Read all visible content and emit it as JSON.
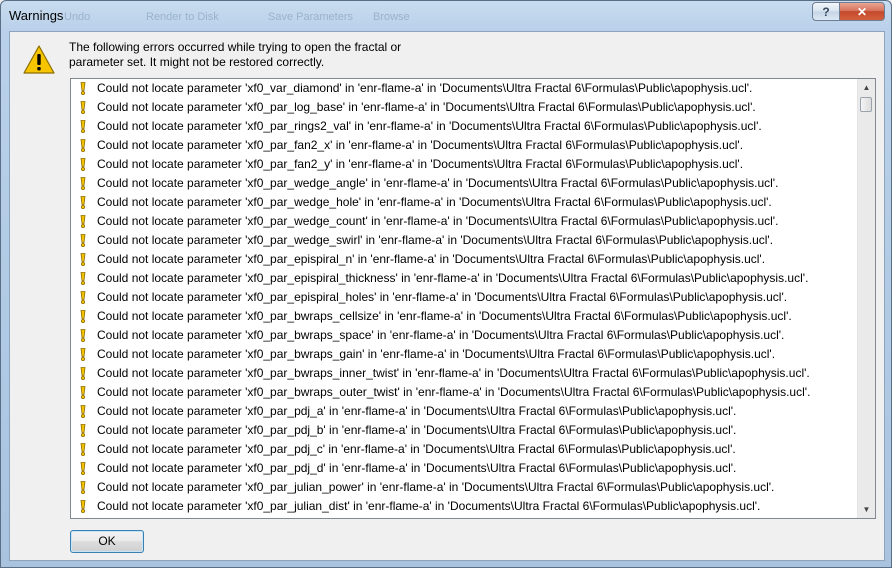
{
  "window": {
    "title": "Warnings"
  },
  "background_toolbar": [
    "Undo",
    "Render to Disk",
    "Save Parameters",
    "Browse"
  ],
  "message": {
    "line1": "The following errors occurred while trying to open the fractal or",
    "line2": "parameter set. It might not be restored correctly."
  },
  "errors": [
    "Could not locate parameter 'xf0_var_diamond' in 'enr-flame-a' in 'Documents\\Ultra Fractal 6\\Formulas\\Public\\apophysis.ucl'.",
    "Could not locate parameter 'xf0_par_log_base' in 'enr-flame-a' in 'Documents\\Ultra Fractal 6\\Formulas\\Public\\apophysis.ucl'.",
    "Could not locate parameter 'xf0_par_rings2_val' in 'enr-flame-a' in 'Documents\\Ultra Fractal 6\\Formulas\\Public\\apophysis.ucl'.",
    "Could not locate parameter 'xf0_par_fan2_x' in 'enr-flame-a' in 'Documents\\Ultra Fractal 6\\Formulas\\Public\\apophysis.ucl'.",
    "Could not locate parameter 'xf0_par_fan2_y' in 'enr-flame-a' in 'Documents\\Ultra Fractal 6\\Formulas\\Public\\apophysis.ucl'.",
    "Could not locate parameter 'xf0_par_wedge_angle' in 'enr-flame-a' in 'Documents\\Ultra Fractal 6\\Formulas\\Public\\apophysis.ucl'.",
    "Could not locate parameter 'xf0_par_wedge_hole' in 'enr-flame-a' in 'Documents\\Ultra Fractal 6\\Formulas\\Public\\apophysis.ucl'.",
    "Could not locate parameter 'xf0_par_wedge_count' in 'enr-flame-a' in 'Documents\\Ultra Fractal 6\\Formulas\\Public\\apophysis.ucl'.",
    "Could not locate parameter 'xf0_par_wedge_swirl' in 'enr-flame-a' in 'Documents\\Ultra Fractal 6\\Formulas\\Public\\apophysis.ucl'.",
    "Could not locate parameter 'xf0_par_epispiral_n' in 'enr-flame-a' in 'Documents\\Ultra Fractal 6\\Formulas\\Public\\apophysis.ucl'.",
    "Could not locate parameter 'xf0_par_epispiral_thickness' in 'enr-flame-a' in 'Documents\\Ultra Fractal 6\\Formulas\\Public\\apophysis.ucl'.",
    "Could not locate parameter 'xf0_par_epispiral_holes' in 'enr-flame-a' in 'Documents\\Ultra Fractal 6\\Formulas\\Public\\apophysis.ucl'.",
    "Could not locate parameter 'xf0_par_bwraps_cellsize' in 'enr-flame-a' in 'Documents\\Ultra Fractal 6\\Formulas\\Public\\apophysis.ucl'.",
    "Could not locate parameter 'xf0_par_bwraps_space' in 'enr-flame-a' in 'Documents\\Ultra Fractal 6\\Formulas\\Public\\apophysis.ucl'.",
    "Could not locate parameter 'xf0_par_bwraps_gain' in 'enr-flame-a' in 'Documents\\Ultra Fractal 6\\Formulas\\Public\\apophysis.ucl'.",
    "Could not locate parameter 'xf0_par_bwraps_inner_twist' in 'enr-flame-a' in 'Documents\\Ultra Fractal 6\\Formulas\\Public\\apophysis.ucl'.",
    "Could not locate parameter 'xf0_par_bwraps_outer_twist' in 'enr-flame-a' in 'Documents\\Ultra Fractal 6\\Formulas\\Public\\apophysis.ucl'.",
    "Could not locate parameter 'xf0_par_pdj_a' in 'enr-flame-a' in 'Documents\\Ultra Fractal 6\\Formulas\\Public\\apophysis.ucl'.",
    "Could not locate parameter 'xf0_par_pdj_b' in 'enr-flame-a' in 'Documents\\Ultra Fractal 6\\Formulas\\Public\\apophysis.ucl'.",
    "Could not locate parameter 'xf0_par_pdj_c' in 'enr-flame-a' in 'Documents\\Ultra Fractal 6\\Formulas\\Public\\apophysis.ucl'.",
    "Could not locate parameter 'xf0_par_pdj_d' in 'enr-flame-a' in 'Documents\\Ultra Fractal 6\\Formulas\\Public\\apophysis.ucl'.",
    "Could not locate parameter 'xf0_par_julian_power' in 'enr-flame-a' in 'Documents\\Ultra Fractal 6\\Formulas\\Public\\apophysis.ucl'.",
    "Could not locate parameter 'xf0_par_julian_dist' in 'enr-flame-a' in 'Documents\\Ultra Fractal 6\\Formulas\\Public\\apophysis.ucl'."
  ],
  "buttons": {
    "ok": "OK"
  },
  "icons": {
    "title_help": "help-icon",
    "title_close": "close-icon",
    "main": "warning-icon",
    "row": "exclamation-icon"
  },
  "colors": {
    "warning_yellow": "#f7c500",
    "close_red": "#c34a2c",
    "focus_blue": "#3c7fb1"
  }
}
